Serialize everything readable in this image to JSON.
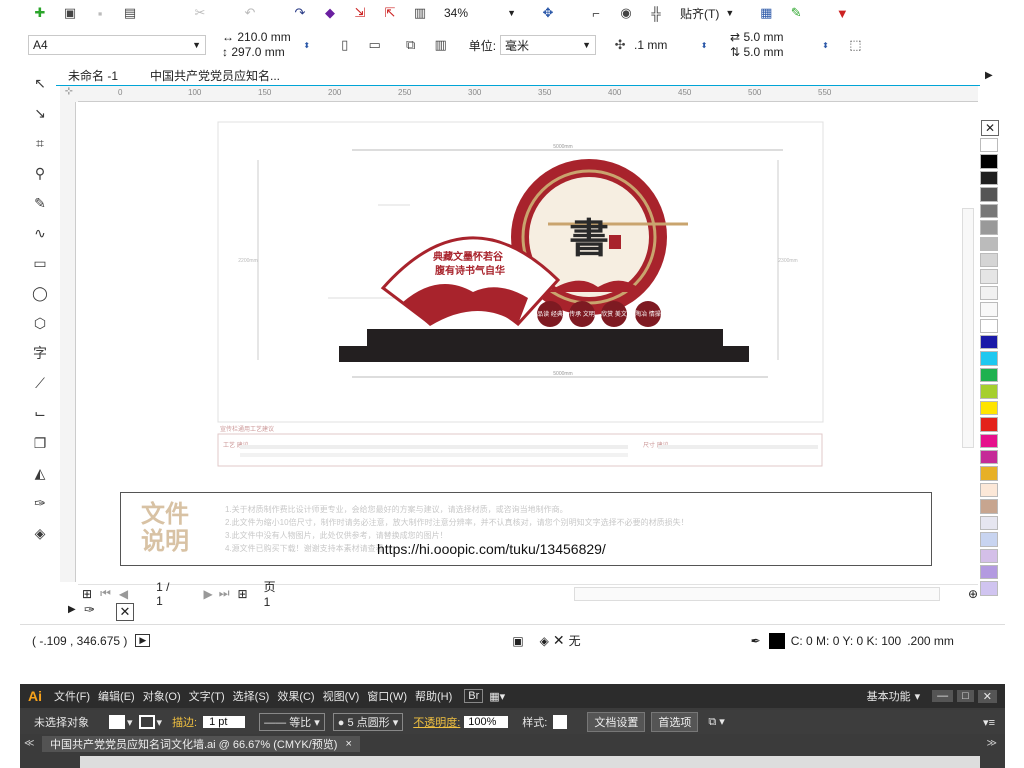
{
  "toolbar": {
    "zoom": "34%",
    "snap_label": "贴齐(T)"
  },
  "property_bar": {
    "paper_size": "A4",
    "width": "210.0 mm",
    "height": "297.0 mm",
    "unit_label": "单位:",
    "unit_value": "毫米",
    "nudge": ".1 mm",
    "dup_x": "5.0 mm",
    "dup_y": "5.0 mm"
  },
  "tabs": [
    {
      "label": "未命名 -1"
    },
    {
      "label": "中国共产党党员应知名..."
    }
  ],
  "ruler_h_ticks": [
    "0",
    "100",
    "150",
    "200",
    "250",
    "300",
    "350",
    "400",
    "450",
    "500",
    "550"
  ],
  "artwork": {
    "dim_top": "5000mm",
    "dim_bottom": "5000mm",
    "dim_left": "2200mm",
    "dim_right": "2300mm",
    "fan_line1": "典藏文墨怀若谷",
    "fan_line2": "腹有诗书气自华",
    "circle_char": "書",
    "circle_badges": [
      "品读 经典",
      "传承 文明",
      "欣赏 美文",
      "陶冶 情操"
    ],
    "spec_title": "宣传栏通用工艺建议",
    "spec_left_label": "工艺 建议",
    "spec_right_label": "尺寸 建议"
  },
  "notes": {
    "title": "文件 说明",
    "lines": [
      "1.关于材质制作费比设计师更专业，会给您最好的方案与建议，请选择材质，或咨询当地制作商。",
      "2.此文件为缩小10倍尺寸，制作时请务必注意，放大制作时注意分辨率，并不认真核对，请您个别明知文字选择不必要的材质损失！",
      "3.此文件中没有人物图片，此处仅供参考，请替换成您的图片！",
      "4.源文件已购买下载！谢谢支持本素材请查看"
    ],
    "url": "https://hi.ooopic.com/tuku/13456829/"
  },
  "page_nav": {
    "page_count": "1 / 1",
    "page_tab": "页 1"
  },
  "status": {
    "coords": "( -.109 , 346.675 )",
    "fill_label": "无",
    "color_info": "C: 0 M: 0 Y: 0 K: 100",
    "outline": ".200 mm"
  },
  "palette": [
    "#ffffff",
    "#000000",
    "#1e1e1e",
    "#555555",
    "#777777",
    "#999999",
    "#bbbbbb",
    "#d5d5d5",
    "#e5e5e5",
    "#f1f1f1",
    "#f8f8f8",
    "#ffffff",
    "#1a1aa8",
    "#1ec8f0",
    "#1fb14f",
    "#a6cf2e",
    "#ffe400",
    "#e4221a",
    "#e6108c",
    "#c52b97",
    "#e7b027",
    "#fce8d8",
    "#c7a58f",
    "#e6e6f0",
    "#c8d4f0",
    "#d4bfe8",
    "#b39ae0",
    "#d0c4f0"
  ],
  "ai": {
    "logo": "Ai",
    "menu": [
      "文件(F)",
      "编辑(E)",
      "对象(O)",
      "文字(T)",
      "选择(S)",
      "效果(C)",
      "视图(V)",
      "窗口(W)",
      "帮助(H)"
    ],
    "workspace": "基本功能",
    "no_selection": "未选择对象",
    "stroke_label": "描边:",
    "stroke_value": "1 pt",
    "uniform": "等比",
    "brush": "5 点圆形",
    "opacity_label": "不透明度:",
    "opacity_value": "100%",
    "style_label": "样式:",
    "doc_setup": "文档设置",
    "prefs": "首选项",
    "doc_tab": "中国共产党党员应知名词文化墙.ai @ 66.67% (CMYK/预览)",
    "doc_tab_close": "×"
  }
}
